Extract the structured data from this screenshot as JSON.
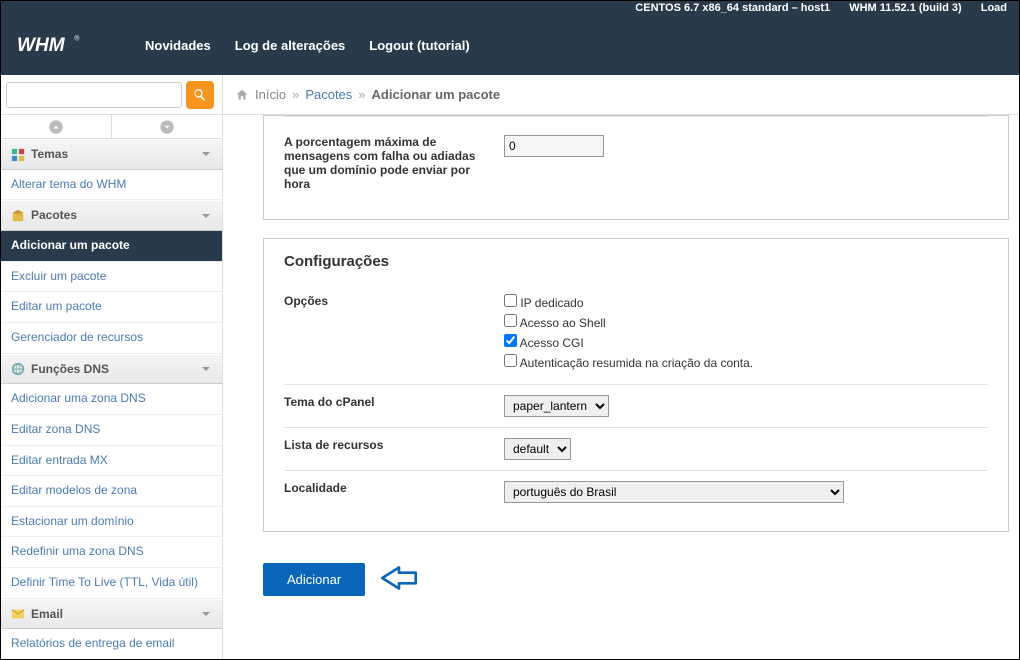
{
  "statusbar": {
    "os": "CENTOS 6.7 x86_64 standard – host1",
    "version": "WHM 11.52.1 (build 3)",
    "load": "Load"
  },
  "nav": {
    "novidades": "Novidades",
    "log": "Log de alterações",
    "logout": "Logout (tutorial)"
  },
  "breadcrumb": {
    "home": "Início",
    "l1": "Pacotes",
    "current": "Adicionar um pacote"
  },
  "sidebar": {
    "groups": [
      {
        "label": "Temas"
      },
      {
        "label": "Pacotes"
      },
      {
        "label": "Funções DNS"
      },
      {
        "label": "Email"
      }
    ],
    "items": {
      "alterar_tema": "Alterar tema do WHM",
      "add_pacote": "Adicionar um pacote",
      "excluir_pacote": "Excluir um pacote",
      "editar_pacote": "Editar um pacote",
      "gerenciador": "Gerenciador de recursos",
      "add_zona": "Adicionar uma zona DNS",
      "edit_zona": "Editar zona DNS",
      "edit_mx": "Editar entrada MX",
      "edit_modelos": "Editar modelos de zona",
      "estacionar": "Estacionar um domínio",
      "redefinir": "Redefinir uma zona DNS",
      "ttl": "Definir Time To Live (TTL, Vida útil)",
      "relatorios": "Relatórios de entrega de email"
    }
  },
  "form": {
    "pct_label": "A porcentagem máxima de mensagens com falha ou adiadas que um domínio pode enviar por hora",
    "pct_value": "0",
    "config_title": "Configurações",
    "opcoes_label": "Opções",
    "opt_ip": "IP dedicado",
    "opt_shell": "Acesso ao Shell",
    "opt_cgi": "Acesso CGI",
    "opt_auth": "Autenticação resumida na criação da conta.",
    "tema_label": "Tema do cPanel",
    "tema_val": "paper_lantern",
    "lista_label": "Lista de recursos",
    "lista_val": "default",
    "locale_label": "Localidade",
    "locale_val": "português do Brasil",
    "button": "Adicionar"
  }
}
